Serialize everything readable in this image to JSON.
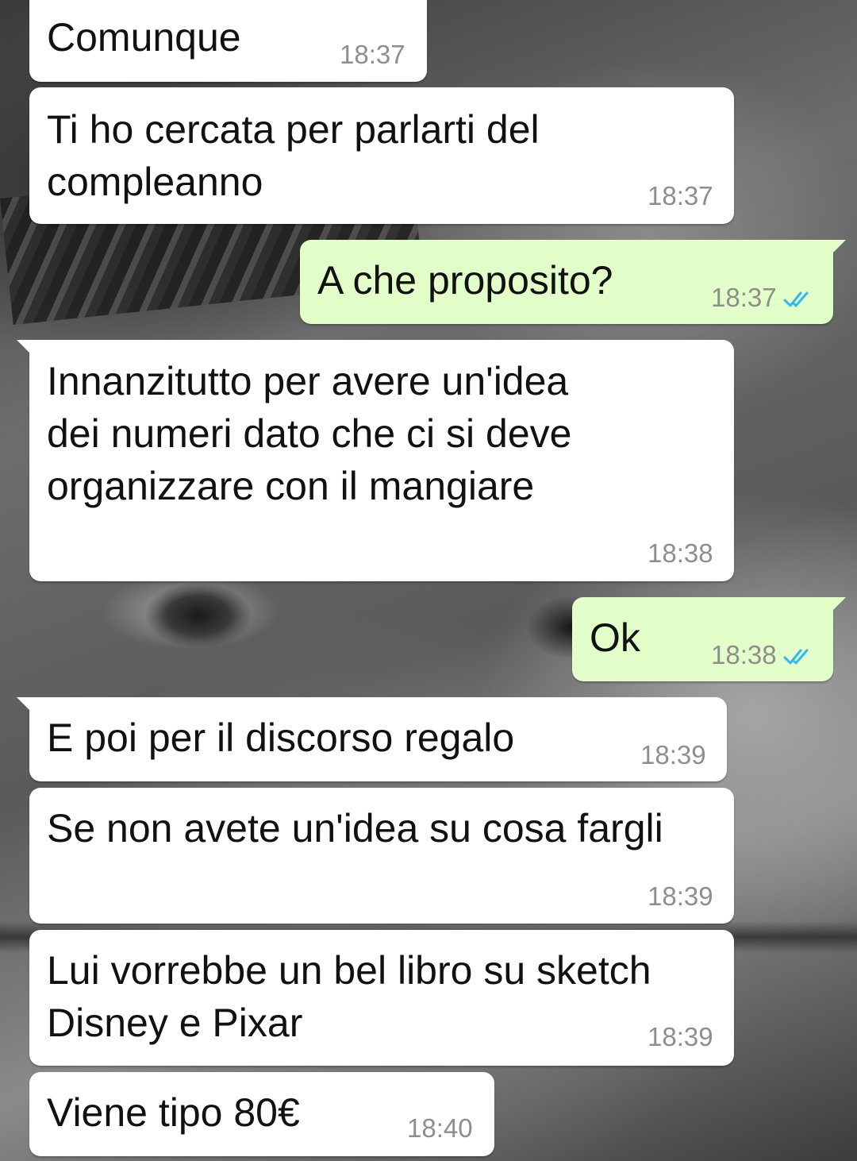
{
  "messages": [
    {
      "direction": "incoming",
      "text": "Comunque",
      "time": "18:37"
    },
    {
      "direction": "incoming",
      "text": "Ti ho cercata per parlarti del\ncompleanno",
      "time": "18:37"
    },
    {
      "direction": "outgoing",
      "text": "A che proposito?",
      "time": "18:37",
      "status_icon": "double-check-icon"
    },
    {
      "direction": "incoming",
      "text": "Innanzitutto per avere un'idea\ndei numeri dato che ci si deve\norganizzare con il mangiare",
      "time": "18:38"
    },
    {
      "direction": "outgoing",
      "text": "Ok",
      "time": "18:38",
      "status_icon": "double-check-icon"
    },
    {
      "direction": "incoming",
      "text": "E poi per il discorso regalo",
      "time": "18:39"
    },
    {
      "direction": "incoming",
      "text": "Se non avete un'idea su cosa fargli",
      "time": "18:39"
    },
    {
      "direction": "incoming",
      "text": "Lui vorrebbe un bel libro su sketch\nDisney e Pixar",
      "time": "18:39"
    },
    {
      "direction": "incoming",
      "text": "Viene tipo 80€",
      "time": "18:40"
    }
  ],
  "colors": {
    "incoming_bubble": "#ffffff",
    "outgoing_bubble": "#e2ffc9",
    "read_tick": "#34b7f1",
    "timestamp": "#8e8e8e"
  }
}
